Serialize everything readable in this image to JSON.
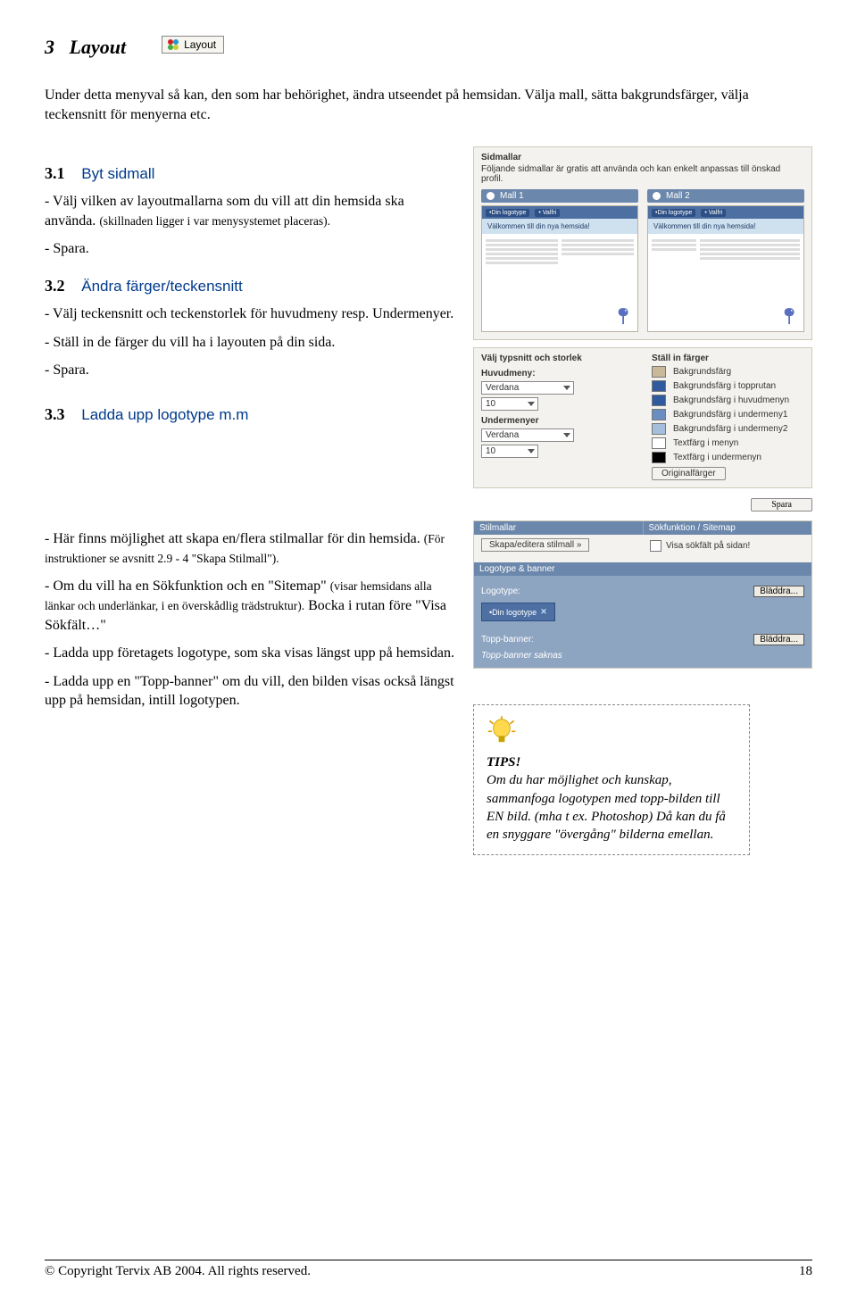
{
  "chapter": {
    "num": "3",
    "title": "Layout",
    "badge": "Layout"
  },
  "intro": "Under detta menyval så kan, den som har behörighet, ändra utseendet på hemsidan. Välja mall, sätta bakgrundsfärger, välja teckensnitt för menyerna etc.",
  "s31": {
    "num": "3.1",
    "title": "Byt sidmall",
    "p1": "- Välj vilken av layoutmallarna som du vill att din hemsida ska använda. ",
    "p1_note": "(skillnaden ligger i var menysystemet placeras).",
    "p2": "- Spara."
  },
  "s32": {
    "num": "3.2",
    "title": "Ändra färger/teckensnitt",
    "p1": "- Välj teckensnitt och teckenstorlek för huvudmeny resp. Undermenyer.",
    "p2": "- Ställ in de färger du vill ha i layouten på din sida.",
    "p3": "- Spara."
  },
  "s33": {
    "num": "3.3",
    "title": "Ladda upp logotype m.m",
    "p1a": "- Här finns möjlighet att skapa en/flera stilmallar för din hemsida. ",
    "p1b": "(För instruktioner se avsnitt 2.9 - 4 \"Skapa Stilmall\").",
    "p2a": "- Om du vill ha en Sökfunktion och en \"Sitemap\" ",
    "p2b": "(visar hemsidans alla länkar och underlänkar, i en överskådlig trädstruktur).",
    "p2c": " Bocka i rutan före \"Visa Sökfält…\"",
    "p3": "- Ladda upp företagets logotype, som ska visas längst upp på hemsidan.",
    "p4": "- Ladda upp en \"Topp-banner\" om du vill, den bilden visas också längst upp på hemsidan, intill logotypen."
  },
  "sidmallar": {
    "title": "Sidmallar",
    "desc": "Följande sidmallar är gratis att använda och kan enkelt anpassas till önskad profil.",
    "opt1": "Mall 1",
    "opt2": "Mall 2",
    "chip_logo": "•Din logotype",
    "chip_valfri": "• Valfri",
    "hero": "Välkommen till din nya hemsida!"
  },
  "typo": {
    "left_title": "Välj typsnitt och storlek",
    "right_title": "Ställ in färger",
    "huvudmeny": "Huvudmeny:",
    "undermeny": "Undermenyer",
    "font": "Verdana",
    "size": "10",
    "colors": [
      {
        "label": "Bakgrundsfärg",
        "hex": "#c9b89a"
      },
      {
        "label": "Bakgrundsfärg i topprutan",
        "hex": "#2f5a9e"
      },
      {
        "label": "Bakgrundsfärg i huvudmenyn",
        "hex": "#2f5a9e"
      },
      {
        "label": "Bakgrundsfärg i undermeny1",
        "hex": "#6a8ec2"
      },
      {
        "label": "Bakgrundsfärg i undermeny2",
        "hex": "#a6bedd"
      },
      {
        "label": "Textfärg i menyn",
        "hex": "#ffffff"
      },
      {
        "label": "Textfärg i undermenyn",
        "hex": "#000000"
      }
    ],
    "reset": "Originalfärger",
    "save": "Spara"
  },
  "stil": {
    "head1": "Stilmallar",
    "head2": "Sökfunktion / Sitemap",
    "btn": "Skapa/editera stilmall »",
    "check": "Visa sökfält på sidan!",
    "logobar": "Logotype & banner",
    "logotype_lbl": "Logotype:",
    "bladdra": "Bläddra...",
    "logo_chip": "•Din logotype",
    "topp_lbl": "Topp-banner:",
    "topp_missing": "Topp-banner saknas"
  },
  "tips": {
    "head": "TIPS!",
    "body": "Om du har möjlighet och kunskap, sammanfoga logotypen med topp-bilden till EN bild. (mha t ex. Photoshop) Då kan du få en snyggare \"övergång\" bilderna emellan."
  },
  "footer": {
    "copyright": "© Copyright Tervix AB 2004. All rights reserved.",
    "page": "18"
  }
}
